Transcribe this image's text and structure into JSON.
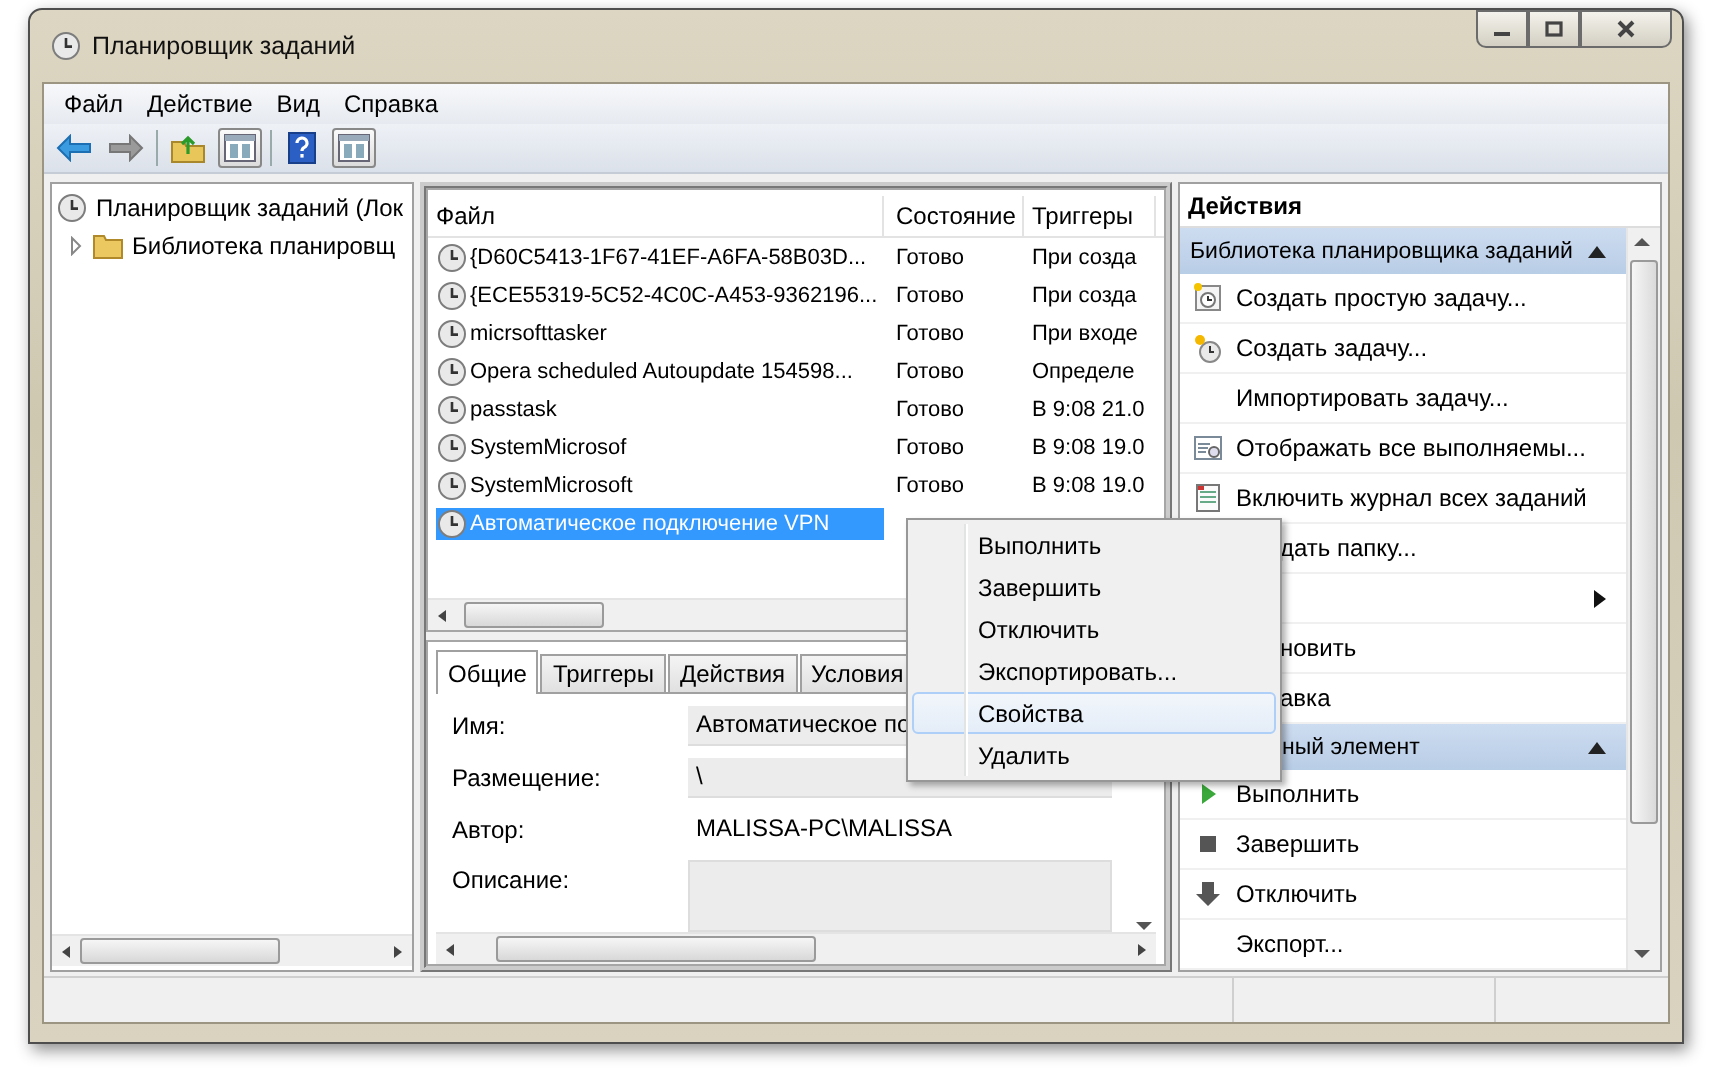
{
  "window": {
    "title": "Планировщик заданий"
  },
  "menu": [
    "Файл",
    "Действие",
    "Вид",
    "Справка"
  ],
  "tree": [
    {
      "label": "Планировщик заданий (Лок",
      "children": [
        {
          "label": "Библиотека планировщ",
          "expanded": false
        }
      ]
    }
  ],
  "task_list": {
    "columns": [
      "Файл",
      "Состояние",
      "Триггеры"
    ],
    "rows": [
      {
        "name": "{D60C5413-1F67-41EF-A6FA-58B03D...",
        "status": "Готово",
        "trigger": "При созда",
        "selected": false
      },
      {
        "name": "{ECE55319-5C52-4C0C-A453-9362196...",
        "status": "Готово",
        "trigger": "При созда",
        "selected": false
      },
      {
        "name": "micrsofttasker",
        "status": "Готово",
        "trigger": "При входе",
        "selected": false
      },
      {
        "name": "Opera scheduled Autoupdate 154598...",
        "status": "Готово",
        "trigger": "Определе",
        "selected": false
      },
      {
        "name": "passtask",
        "status": "Готово",
        "trigger": "В 9:08 21.0",
        "selected": false
      },
      {
        "name": "SystemMicrosof",
        "status": "Готово",
        "trigger": "В 9:08 19.0",
        "selected": false
      },
      {
        "name": "SystemMicrosoft",
        "status": "Готово",
        "trigger": "В 9:08 19.0",
        "selected": false
      },
      {
        "name": "Автоматическое подключение VPN",
        "selected": true
      }
    ]
  },
  "details": {
    "tabs": [
      {
        "label": "Общие",
        "selected": true
      },
      {
        "label": "Триггеры",
        "selected": false
      },
      {
        "label": "Действия",
        "selected": false
      },
      {
        "label": "Условия",
        "selected": false
      }
    ],
    "fields": [
      {
        "label": "Имя:",
        "value": "Автоматическое по",
        "kind": "box"
      },
      {
        "label": "Размещение:",
        "value": "\\",
        "kind": "box"
      },
      {
        "label": "Автор:",
        "value": "MALISSA-PC\\MALISSA",
        "kind": "plain"
      },
      {
        "label": "Описание:",
        "kind": "area"
      }
    ]
  },
  "actions": {
    "title": "Действия",
    "sections": [
      {
        "header": "Библиотека планировщика заданий",
        "expanded": true,
        "covered": false,
        "items": [
          {
            "label": "Создать простую задачу...",
            "kind": "wizard"
          },
          {
            "label": "Создать задачу...",
            "kind": "task"
          },
          {
            "label": "Импортировать задачу...",
            "kind": "plain"
          },
          {
            "label": "Отображать все выполняемы...",
            "kind": "list"
          },
          {
            "label": "Включить журнал всех заданий",
            "kind": "journal"
          },
          {
            "label": "дать папку...",
            "kind": "plain",
            "covered": true
          },
          {
            "kind": "plain",
            "submenu": true
          },
          {
            "label": "новить",
            "kind": "plain",
            "covered": true
          },
          {
            "label": "авка",
            "kind": "plain",
            "covered": true
          }
        ]
      },
      {
        "header": "ный элемент",
        "expanded": true,
        "covered": true,
        "items": [
          {
            "label": "Выполнить",
            "kind": "play"
          },
          {
            "label": "Завершить",
            "kind": "stop"
          },
          {
            "label": "Отключить",
            "kind": "down"
          },
          {
            "label": "Экспорт...",
            "kind": "plain"
          }
        ]
      }
    ]
  },
  "context_menu": [
    {
      "label": "Выполнить",
      "selected": false
    },
    {
      "label": "Завершить",
      "selected": false
    },
    {
      "label": "Отключить",
      "selected": false
    },
    {
      "label": "Экспортировать...",
      "selected": false
    },
    {
      "label": "Свойства",
      "selected": true
    },
    {
      "label": "Удалить",
      "selected": false
    }
  ]
}
